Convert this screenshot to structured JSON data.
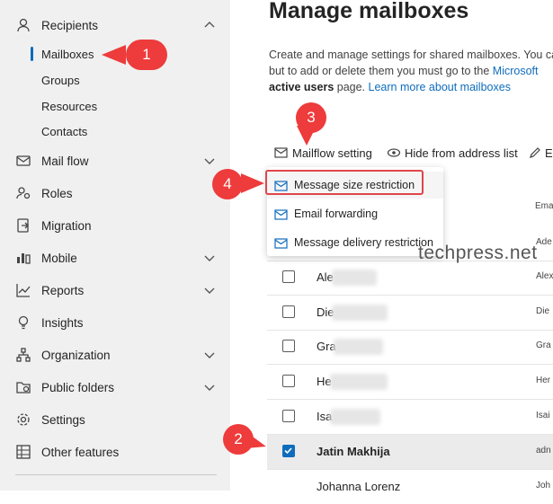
{
  "sidebar": {
    "recipients_label": "Recipients",
    "sub_items": [
      "Mailboxes",
      "Groups",
      "Resources",
      "Contacts"
    ],
    "items": [
      {
        "label": "Mail flow",
        "icon": "mail-icon",
        "expandable": true
      },
      {
        "label": "Roles",
        "icon": "roles-icon",
        "expandable": false
      },
      {
        "label": "Migration",
        "icon": "migration-icon",
        "expandable": false
      },
      {
        "label": "Mobile",
        "icon": "mobile-icon",
        "expandable": true
      },
      {
        "label": "Reports",
        "icon": "reports-icon",
        "expandable": true
      },
      {
        "label": "Insights",
        "icon": "lightbulb-icon",
        "expandable": false
      },
      {
        "label": "Organization",
        "icon": "organization-icon",
        "expandable": true
      },
      {
        "label": "Public folders",
        "icon": "public-folders-icon",
        "expandable": true
      },
      {
        "label": "Settings",
        "icon": "gear-icon",
        "expandable": false
      },
      {
        "label": "Other features",
        "icon": "grid-icon",
        "expandable": false
      }
    ]
  },
  "main": {
    "title": "Manage mailboxes",
    "desc_line1": "Create and manage settings for shared mailboxes. You ca",
    "desc_line2_a": "but to add or delete them you must go to the ",
    "desc_line2_link": "Microsoft",
    "desc_line3_bold": "active users",
    "desc_line3_mid": " page. ",
    "desc_line3_link": "Learn more about mailboxes"
  },
  "toolbar": {
    "mailflow_label": "Mailflow setting",
    "hide_label": "Hide from address list",
    "edit_label": "E"
  },
  "dropdown": {
    "items": [
      "Message size restriction",
      "Email forwarding",
      "Message delivery restriction"
    ]
  },
  "table": {
    "header_email": "Ema",
    "rows": [
      {
        "name": "",
        "email": "Ade",
        "checked": false
      },
      {
        "name": "Ale",
        "email": "Alex",
        "checked": false
      },
      {
        "name": "Die",
        "email": "Die",
        "checked": false
      },
      {
        "name": "Gra",
        "email": "Gra",
        "checked": false
      },
      {
        "name": "He",
        "email": "Her",
        "checked": false
      },
      {
        "name": "Isa",
        "email": "Isai",
        "checked": false
      },
      {
        "name": "Jatin Makhija",
        "email": "adn",
        "checked": true
      },
      {
        "name": "Johanna Lorenz",
        "email": "Joh",
        "checked": false
      }
    ]
  },
  "callouts": [
    "1",
    "2",
    "3",
    "4"
  ],
  "watermark": "techpress.net",
  "colors": {
    "accent": "#0f6cbd",
    "callout": "#ee3b3b",
    "selected_row": "#ebebeb"
  }
}
